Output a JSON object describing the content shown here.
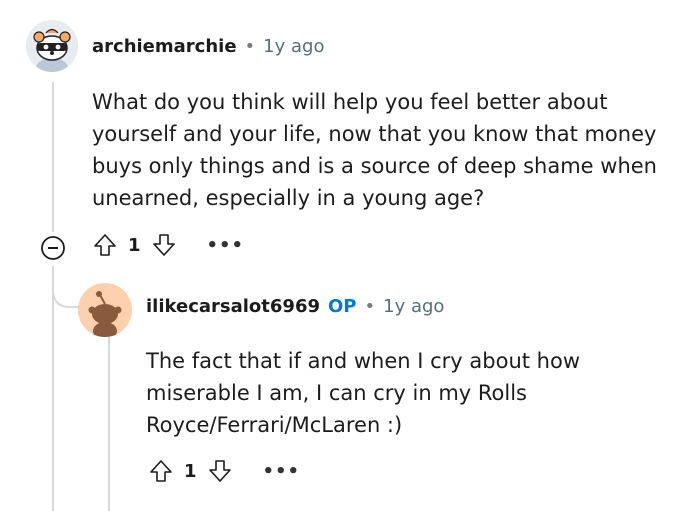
{
  "comments": [
    {
      "author": "archiemarchie",
      "separator": "•",
      "time": "1y ago",
      "body": "What do you think will help you feel better about yourself and your life, now that you know that money buys only things and is a source of deep shame when unearned, especially in a young age?",
      "votes": "1",
      "more": "•••",
      "icons": {
        "upvote": "upvote-arrow-icon",
        "downvote": "downvote-arrow-icon",
        "collapse": "collapse-minus-icon",
        "more": "more-options-icon"
      }
    },
    {
      "author": "ilikecarsalot6969",
      "badge": "OP",
      "separator": "•",
      "time": "1y ago",
      "body": "The fact that if and when I cry about how\nmiserable I am, I can cry in my Rolls\nRoyce/Ferrari/McLaren :)",
      "votes": "1",
      "more": "•••",
      "icons": {
        "upvote": "upvote-arrow-icon",
        "downvote": "downvote-arrow-icon",
        "more": "more-options-icon"
      }
    }
  ],
  "colors": {
    "op_badge": "#0079d3",
    "thread_line": "#d6d9dc",
    "avatar2_bg": "#fdd1b0"
  }
}
